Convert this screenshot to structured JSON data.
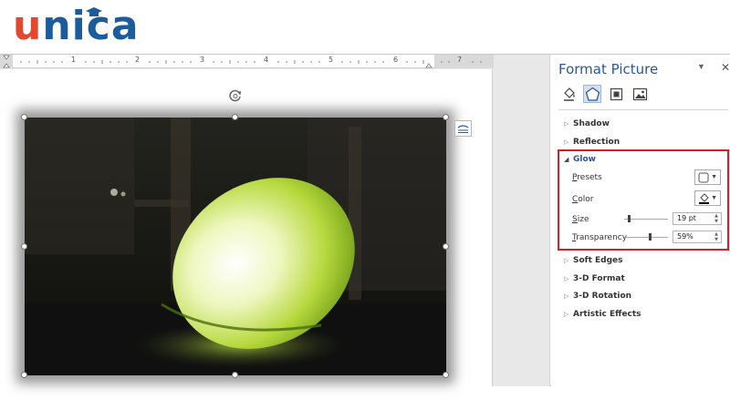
{
  "brand": {
    "logo_text_first": "u",
    "logo_text_rest": "nica",
    "accent_orange": "#e0492f",
    "accent_blue": "#1b5d9c"
  },
  "ruler": {
    "numbers": [
      "1",
      "2",
      "3",
      "4",
      "5",
      "6",
      "7"
    ]
  },
  "document": {
    "picture_icon": "lamp-photo",
    "rotate_icon": "rotate-handle-icon",
    "layout_icon": "layout-options-icon"
  },
  "pane": {
    "title": "Format Picture",
    "dropdown_icon": "chevron-down-icon",
    "close_icon": "close-icon",
    "tabs": [
      "fill-line-icon",
      "effects-icon",
      "layout-properties-icon",
      "picture-icon"
    ],
    "sections": {
      "shadow": "Shadow",
      "reflection": "Reflection",
      "glow": "Glow",
      "soft_edges": "Soft Edges",
      "format_3d": "3-D Format",
      "rotation_3d": "3-D Rotation",
      "artistic": "Artistic Effects"
    },
    "glow": {
      "presets_accel": "P",
      "presets_rest": "resets",
      "color_accel": "C",
      "color_rest": "olor",
      "size_accel": "S",
      "size_rest": "ize",
      "size_value": "19 pt",
      "size_level": 0.1,
      "transparency_accel": "T",
      "transparency_rest": "ransparency",
      "transparency_value": "59%",
      "transparency_level": 0.59
    },
    "highlight_color": "#d41f26"
  }
}
